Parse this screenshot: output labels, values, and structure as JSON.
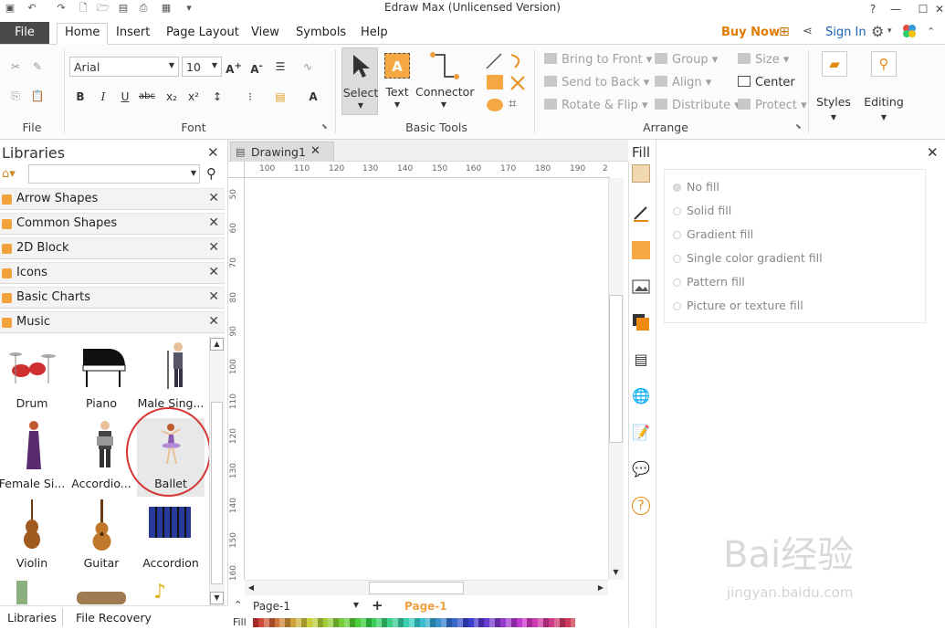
{
  "window": {
    "title": "Edraw Max (Unlicensed Version)"
  },
  "ribbon_tabs": [
    {
      "label": "File"
    },
    {
      "label": "Home"
    },
    {
      "label": "Insert"
    },
    {
      "label": "Page Layout"
    },
    {
      "label": "View"
    },
    {
      "label": "Symbols"
    },
    {
      "label": "Help"
    }
  ],
  "header_right": {
    "buy_now": "Buy Now",
    "sign_in": "Sign In"
  },
  "font_group": {
    "font_name": "Arial",
    "font_size": "10",
    "label": "Font"
  },
  "file_group": {
    "label": "File"
  },
  "basic_tools": {
    "select": "Select",
    "text": "Text",
    "connector": "Connector",
    "label": "Basic Tools"
  },
  "arrange": {
    "bring_to_front": "Bring to Front",
    "send_to_back": "Send to Back",
    "rotate_flip": "Rotate & Flip",
    "group": "Group",
    "align": "Align",
    "distribute": "Distribute",
    "size": "Size",
    "center": "Center",
    "protect": "Protect",
    "label": "Arrange"
  },
  "styles_label": "Styles",
  "editing_label": "Editing",
  "libraries": {
    "title": "Libraries",
    "categories": [
      "Arrow Shapes",
      "Common Shapes",
      "2D Block",
      "Icons",
      "Basic Charts",
      "Music"
    ],
    "shapes": [
      "Drum",
      "Piano",
      "Male Sing...",
      "Female Si...",
      "Accordio...",
      "Ballet",
      "Violin",
      "Guitar",
      "Accordion"
    ],
    "bottom_tabs": [
      "Libraries",
      "File Recovery"
    ]
  },
  "document": {
    "tab": "Drawing1",
    "hruler_ticks": [
      "100",
      "110",
      "120",
      "130",
      "140",
      "150",
      "160",
      "170",
      "180",
      "190",
      "2"
    ],
    "vruler_ticks": [
      "50",
      "60",
      "70",
      "80",
      "90",
      "100",
      "110",
      "120",
      "130",
      "140",
      "150",
      "160"
    ],
    "page_name": "Page-1",
    "active_page": "Page-1",
    "fill_label": "Fill"
  },
  "fill_panel": {
    "title": "Fill",
    "options": [
      "No fill",
      "Solid fill",
      "Gradient fill",
      "Single color gradient fill",
      "Pattern fill",
      "Picture or texture fill"
    ]
  },
  "watermark": {
    "main": "Bai经验",
    "sub": "jingyan.baidu.com"
  },
  "colors": {
    "accent": "#e07b00",
    "file_tab": "#4a4a4a",
    "highlight": "#d63333"
  }
}
